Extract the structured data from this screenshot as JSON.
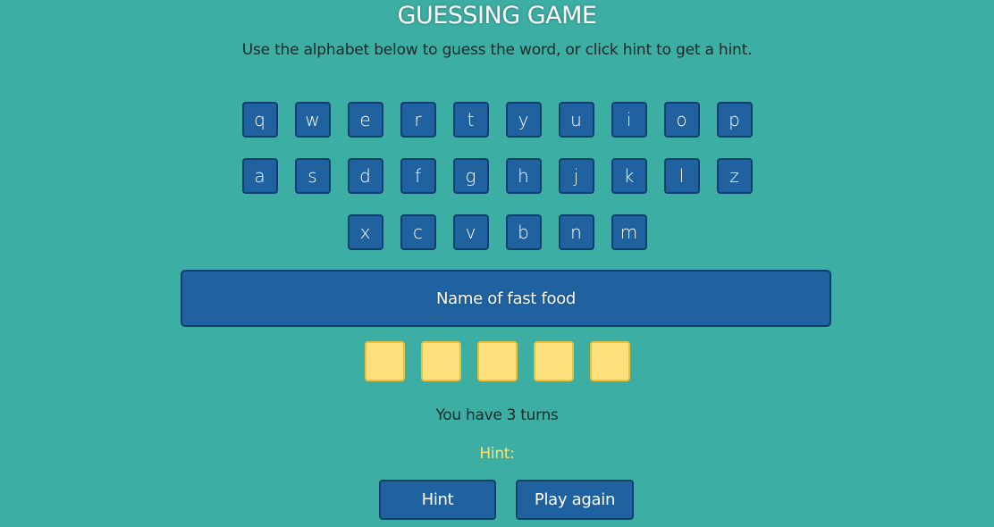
{
  "title": "GUESSING GAME",
  "subtitle": "Use the alphabet below to guess the word, or click hint to get a hint.",
  "keyboard": {
    "row1": [
      "q",
      "w",
      "e",
      "r",
      "t",
      "y",
      "u",
      "i",
      "o",
      "p"
    ],
    "row2": [
      "a",
      "s",
      "d",
      "f",
      "g",
      "h",
      "j",
      "k",
      "l",
      "z"
    ],
    "row3": [
      "x",
      "c",
      "v",
      "b",
      "n",
      "m"
    ]
  },
  "category": "Name of fast food",
  "word_slots": [
    "",
    "",
    "",
    "",
    ""
  ],
  "turns_text": "You have 3 turns",
  "hint_text": "Hint:",
  "buttons": {
    "hint": "Hint",
    "play_again": "Play again"
  },
  "colors": {
    "background": "#3daea4",
    "key": "#2062a0",
    "slot": "#fce07b",
    "hint_text": "#f9e27a"
  }
}
